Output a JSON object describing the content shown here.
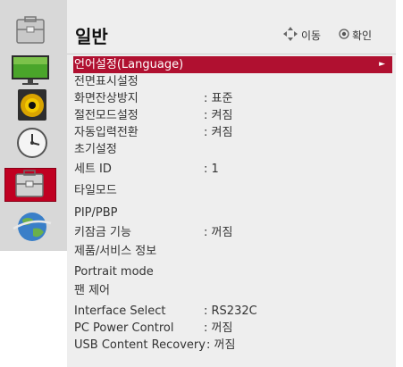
{
  "header": {
    "title": "일반",
    "move_hint": "이동",
    "confirm_hint": "확인"
  },
  "sidebar": {
    "items": [
      {
        "icon": "toolbox-icon"
      },
      {
        "icon": "monitor-icon"
      },
      {
        "icon": "speaker-icon"
      },
      {
        "icon": "clock-icon"
      },
      {
        "icon": "toolbox-icon",
        "active": true
      },
      {
        "icon": "globe-icon"
      }
    ]
  },
  "menu": {
    "items": [
      {
        "label": "언어설정(Language)",
        "value": "",
        "selected": true
      },
      {
        "label": "전면표시설정",
        "value": ""
      },
      {
        "label": "화면잔상방지",
        "value": ": 표준"
      },
      {
        "label": "절전모드설정",
        "value": ": 켜짐"
      },
      {
        "label": "자동입력전환",
        "value": ": 켜짐"
      },
      {
        "label": "초기설정",
        "value": ""
      },
      {
        "label": "세트 ID",
        "value": ": 1"
      },
      {
        "label": "타일모드",
        "value": ""
      },
      {
        "label": "PIP/PBP",
        "value": ""
      },
      {
        "label": "키잠금 기능",
        "value": ": 꺼짐"
      },
      {
        "label": "제품/서비스 정보",
        "value": ""
      },
      {
        "label": "Portrait mode",
        "value": ""
      },
      {
        "label": "팬 제어",
        "value": ""
      },
      {
        "label": "Interface Select",
        "value": ": RS232C"
      },
      {
        "label": "PC Power Control",
        "value": ": 꺼짐"
      },
      {
        "label": "USB Content Recovery",
        "value": ": 꺼짐"
      }
    ]
  },
  "colors": {
    "selected_row": "#b01030",
    "active_tab": "#c00021",
    "panel_bg": "#eeeeee",
    "sidebar_bg": "#d8d8d8"
  }
}
